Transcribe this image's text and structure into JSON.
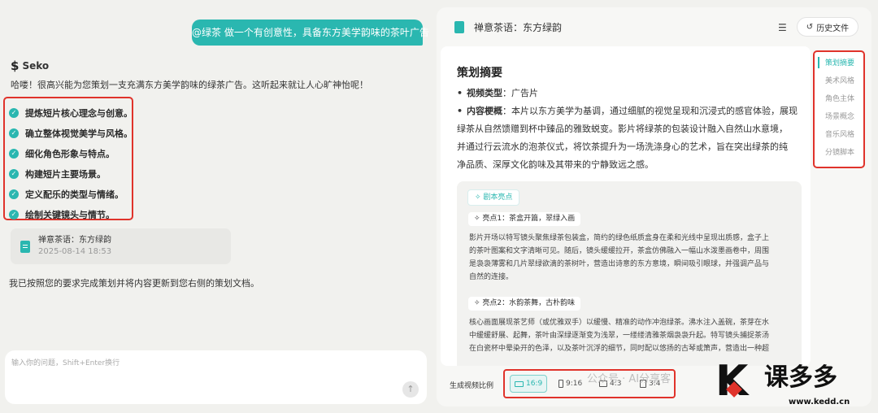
{
  "chat": {
    "user_message": "@绿茶 做一个有创意性，具备东方美学韵味的茶叶广告",
    "brand": "Seko",
    "greeting": "哈喽！很高兴能为您策划一支充满东方美学韵味的绿茶广告。这听起来就让人心旷神怡呢！",
    "tasks": [
      "提炼短片核心理念与创意。",
      "确立整体视觉美学与风格。",
      "细化角色形象与特点。",
      "构建短片主要场景。",
      "定义配乐的类型与情绪。",
      "绘制关键镜头与情节。"
    ],
    "doc_card": {
      "title": "禅意茶语：东方绿韵",
      "date": "2025-08-14 18:53"
    },
    "done_message": "我已按照您的要求完成策划并将内容更新到您右侧的策划文档。",
    "input_placeholder": "输入你的问题，Shift+Enter换行"
  },
  "panel": {
    "title": "禅意茶语：东方绿韵",
    "history_label": "历史文件",
    "summary_heading": "策划摘要",
    "video_type_label": "视频类型",
    "video_type_value": "：广告片",
    "overview_label": "内容梗概",
    "overview_lines": [
      "：本片以东方美学为基调，通过细腻的视觉呈现和沉浸式的感官体验，展现",
      "绿茶从自然馈赠到杯中臻品的雅致蜕变。影片将绿茶的包装设计融入自然山水意境，",
      "并通过行云流水的泡茶仪式，将饮茶提升为一场洗涤身心的艺术，旨在突出绿茶的纯",
      "净品质、深厚文化韵味及其带来的宁静致远之感。"
    ],
    "highlights_tag": "剧本亮点",
    "points": [
      {
        "title": "亮点1：茶盒开篇，翠绿入画",
        "lines": [
          "影片开场以特写镜头聚焦绿茶包装盒，简约的绿色纸质盒身在柔和光线中呈现出质感，盒子上",
          "的茶叶图案和文字清晰可见。随后，镜头缓缓拉开，茶盒仿佛融入一幅山水泼墨画卷中，周围",
          "是袅袅薄雾和几片翠绿欲滴的茶树叶，营造出诗意的东方意境，瞬间吸引眼球，并强调产品与",
          "自然的连接。"
        ]
      },
      {
        "title": "亮点2：水韵茶舞，古朴韵味",
        "lines": [
          "核心画面展现茶艺师（或优雅双手）以缓慢、精准的动作冲泡绿茶。沸水注入盖碗，茶芽在水",
          "中缓缓舒展、起舞，茶叶由深绿逐渐变为浅翠，一缕缕清雅茶烟袅袅升起。特写镜头捕捉茶汤",
          "在白瓷杯中晕染开的色泽，以及茶叶沉浮的细节，同时配以悠扬的古琴或箫声，营造出一种超"
        ]
      }
    ],
    "ratio_label": "生成视频比例",
    "ratios": [
      "16:9",
      "9:16",
      "4:3",
      "3:4"
    ],
    "selected_ratio": "16:9"
  },
  "toc": [
    "策划摘要",
    "美术风格",
    "角色主体",
    "场景概念",
    "音乐风格",
    "分镜脚本"
  ],
  "watermark": {
    "text": "公众号 · AI分享客",
    "logo_letter": "K",
    "logo_name": "课多多",
    "logo_url": "www.kedd.cn"
  },
  "colors": {
    "accent": "#2ab7b0",
    "highlight_box": "#e0332b"
  }
}
